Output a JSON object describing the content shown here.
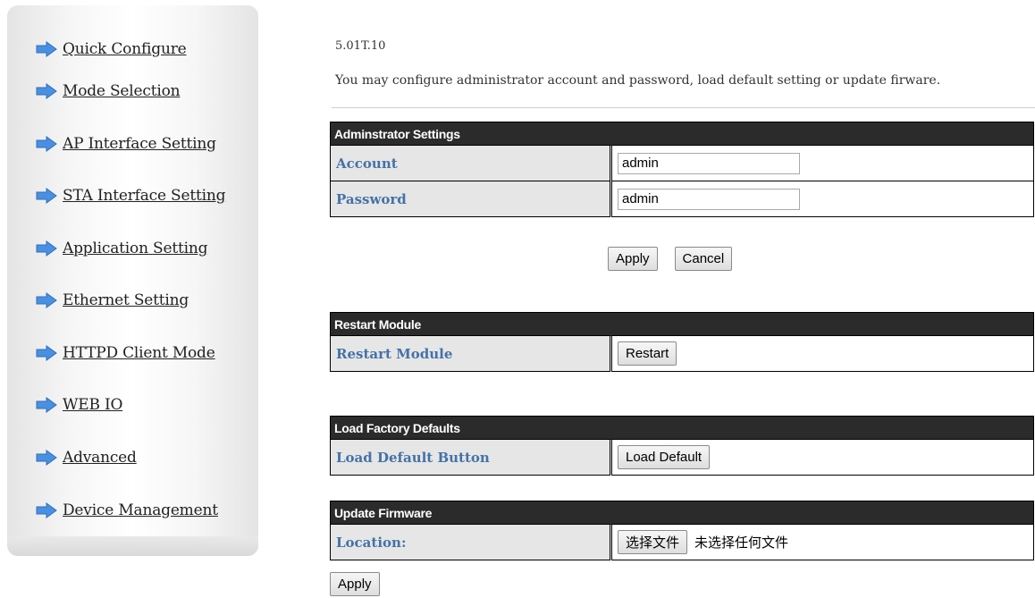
{
  "sidebar": {
    "items": [
      {
        "label": "Quick Configure"
      },
      {
        "label": "Mode Selection"
      },
      {
        "label": "AP Interface Setting"
      },
      {
        "label": "STA Interface Setting"
      },
      {
        "label": "Application Setting"
      },
      {
        "label": "Ethernet Setting"
      },
      {
        "label": "HTTPD Client Mode"
      },
      {
        "label": "WEB IO"
      },
      {
        "label": "Advanced"
      },
      {
        "label": "Device Management"
      }
    ]
  },
  "page": {
    "version": "5.01T.10",
    "intro": "You may configure administrator account and password, load default setting or update firware."
  },
  "admin": {
    "header": "Adminstrator Settings",
    "account_label": "Account",
    "account_value": "admin",
    "password_label": "Password",
    "password_value": "admin",
    "apply_label": "Apply",
    "cancel_label": "Cancel"
  },
  "restart": {
    "header": "Restart Module",
    "label": "Restart Module",
    "button_label": "Restart"
  },
  "factory": {
    "header": "Load Factory Defaults",
    "label": "Load Default Button",
    "button_label": "Load Default"
  },
  "firmware": {
    "header": "Update Firmware",
    "label": "Location:",
    "choose_file_label": "选择文件",
    "file_status": "未选择任何文件",
    "apply_label": "Apply"
  },
  "colors": {
    "header_bg": "#2b2b2b",
    "label_text": "#4472a8",
    "label_bg": "#e6e6e6",
    "arrow": "#4a90e2"
  },
  "icons": {
    "nav_item_icon": "right-arrow-icon"
  }
}
